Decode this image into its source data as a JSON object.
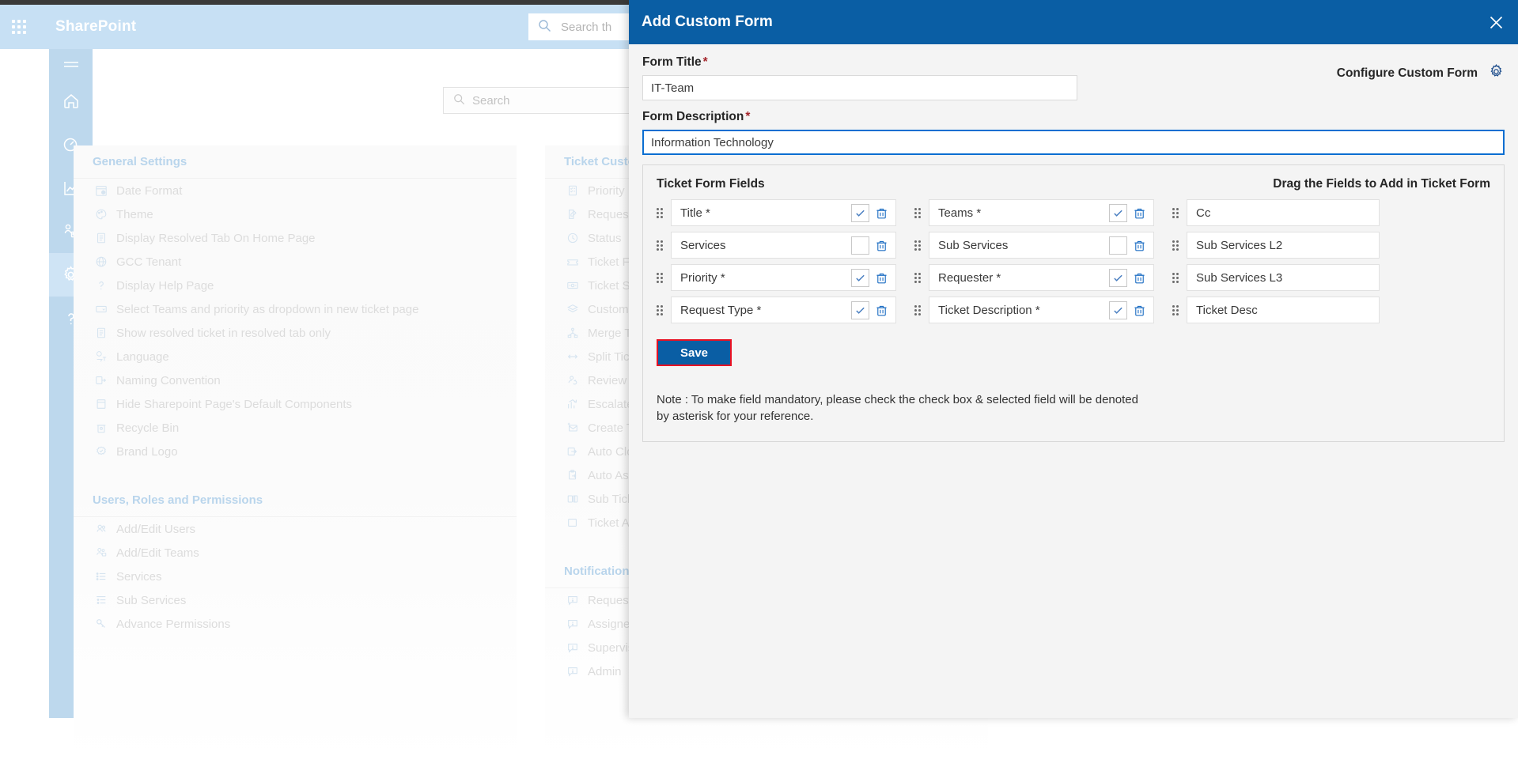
{
  "suitebar": {
    "brand": "SharePoint",
    "waffle_icon": "app-launcher-icon",
    "search_placeholder": "Search th",
    "search_icon": "search-icon"
  },
  "rail": {
    "items": [
      {
        "icon": "hamburger-icon",
        "name": "menu-toggle"
      },
      {
        "icon": "home-icon",
        "name": "home"
      },
      {
        "icon": "dashboard-icon",
        "name": "dashboard"
      },
      {
        "icon": "analytics-icon",
        "name": "analytics"
      },
      {
        "icon": "team-icon",
        "name": "teams"
      },
      {
        "icon": "gear-icon",
        "name": "settings",
        "active": true
      },
      {
        "icon": "help-icon",
        "name": "help"
      }
    ]
  },
  "page": {
    "search_placeholder": "Search",
    "search_icon": "search-icon"
  },
  "settings": {
    "columns": [
      {
        "groups": [
          {
            "title": "General Settings",
            "items": [
              {
                "label": "Date Format",
                "icon": "calendar-clock-icon"
              },
              {
                "label": "Theme",
                "icon": "palette-icon"
              },
              {
                "label": "Display Resolved Tab On Home Page",
                "icon": "document-icon"
              },
              {
                "label": "GCC Tenant",
                "icon": "globe-icon"
              },
              {
                "label": "Display Help Page",
                "icon": "question-icon"
              },
              {
                "label": "Select Teams and priority as dropdown in new ticket page",
                "icon": "dropdown-icon"
              },
              {
                "label": "Show resolved ticket in resolved tab only",
                "icon": "document-icon"
              },
              {
                "label": "Language",
                "icon": "language-icon"
              },
              {
                "label": "Naming Convention",
                "icon": "naming-icon"
              },
              {
                "label": "Hide Sharepoint Page's Default Components",
                "icon": "page-icon"
              },
              {
                "label": "Recycle Bin",
                "icon": "recycle-bin-icon"
              },
              {
                "label": "Brand Logo",
                "icon": "badge-icon"
              }
            ]
          },
          {
            "title": "Users, Roles and Permissions",
            "items": [
              {
                "label": "Add/Edit Users",
                "icon": "users-icon"
              },
              {
                "label": "Add/Edit Teams",
                "icon": "team-add-icon"
              },
              {
                "label": "Services",
                "icon": "list-icon"
              },
              {
                "label": "Sub Services",
                "icon": "sub-list-icon"
              },
              {
                "label": "Advance Permissions",
                "icon": "key-icon"
              }
            ]
          }
        ]
      },
      {
        "groups": [
          {
            "title": "Ticket Customization",
            "items": [
              {
                "label": "Priority",
                "icon": "priority-icon"
              },
              {
                "label": "Request Type",
                "icon": "request-icon"
              },
              {
                "label": "Status",
                "icon": "status-clock-icon"
              },
              {
                "label": "Ticket Form",
                "icon": "ticket-icon"
              },
              {
                "label": "Ticket Settings",
                "icon": "ticket-settings-icon"
              },
              {
                "label": "Custom Fields",
                "icon": "layers-icon"
              },
              {
                "label": "Merge Ticket",
                "icon": "merge-icon"
              },
              {
                "label": "Split Ticket",
                "icon": "split-icon"
              },
              {
                "label": "Review Ticket",
                "icon": "review-icon"
              },
              {
                "label": "Escalate Ticket",
                "icon": "escalate-icon"
              },
              {
                "label": "Create Ticket",
                "icon": "create-ticket-icon"
              },
              {
                "label": "Auto Close",
                "icon": "auto-close-icon"
              },
              {
                "label": "Auto Assign",
                "icon": "auto-assign-icon"
              },
              {
                "label": "Sub Ticket",
                "icon": "sub-ticket-icon"
              },
              {
                "label": "Ticket Approval",
                "icon": "approval-icon"
              }
            ]
          },
          {
            "title": "Notification",
            "items": [
              {
                "label": "Requester",
                "icon": "comment-icon"
              },
              {
                "label": "Assignee",
                "icon": "comment-icon"
              },
              {
                "label": "Supervisor",
                "icon": "comment-icon"
              },
              {
                "label": "Admin",
                "icon": "comment-icon"
              }
            ]
          }
        ]
      }
    ]
  },
  "modal": {
    "title": "Add Custom Form",
    "close_icon": "close-icon",
    "form_title_label": "Form Title",
    "form_title_value": "IT-Team",
    "form_description_label": "Form Description",
    "form_description_value": "Information Technology",
    "required_marker": "*",
    "configure_label": "Configure Custom Form",
    "configure_icon": "gear-icon",
    "panel": {
      "left_heading": "Ticket Form Fields",
      "right_heading": "Drag the Fields to Add in Ticket Form",
      "grip_icon": "drag-handle-icon",
      "check_icon": "check-icon",
      "delete_icon": "trash-icon",
      "column1": [
        {
          "label": "Title *",
          "checked": true
        },
        {
          "label": "Services",
          "checked": false
        },
        {
          "label": "Priority *",
          "checked": true
        },
        {
          "label": "Request Type *",
          "checked": true
        }
      ],
      "column2": [
        {
          "label": "Teams *",
          "checked": true
        },
        {
          "label": "Sub Services",
          "checked": false
        },
        {
          "label": "Requester *",
          "checked": true
        },
        {
          "label": "Ticket Description *",
          "checked": true
        }
      ],
      "column3": [
        {
          "label": "Cc"
        },
        {
          "label": "Sub Services L2"
        },
        {
          "label": "Sub Services L3"
        },
        {
          "label": "Ticket Desc"
        }
      ]
    },
    "save_label": "Save",
    "note": "Note : To make field mandatory, please check the check box & selected field will be denoted by asterisk for your reference."
  },
  "colors": {
    "suitebar": "#c7e0f4",
    "modal_header": "#0a5ea4",
    "save_button": "#0a5ea4",
    "save_highlight": "#e81123",
    "focus_border": "#0a6ed1",
    "required": "#a4262c",
    "rail": "#bdd8ed"
  }
}
